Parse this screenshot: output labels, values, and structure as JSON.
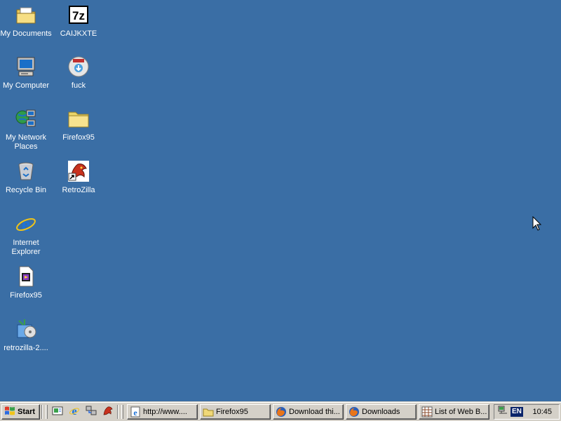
{
  "desktop": {
    "background": "#3a6ea5",
    "icons": [
      {
        "label": "My Documents",
        "icon": "folder-documents-icon"
      },
      {
        "label": "CAIJKXTE",
        "icon": "7z-archive-icon"
      },
      {
        "label": "My Computer",
        "icon": "computer-icon"
      },
      {
        "label": "fuck",
        "icon": "installer-disc-icon"
      },
      {
        "label": "My Network Places",
        "icon": "network-places-icon"
      },
      {
        "label": "Firefox95",
        "icon": "folder-icon"
      },
      {
        "label": "Recycle Bin",
        "icon": "recycle-bin-icon"
      },
      {
        "label": "RetroZilla",
        "icon": "retrozilla-icon"
      },
      {
        "label": "Internet Explorer",
        "icon": "internet-explorer-icon"
      },
      {
        "label": "Firefox95",
        "icon": "media-file-icon"
      },
      {
        "label": "retrozilla-2....",
        "icon": "setup-package-icon"
      }
    ]
  },
  "taskbar": {
    "start_label": "Start",
    "quick_launch": [
      {
        "icon": "show-desktop-icon"
      },
      {
        "icon": "internet-explorer-icon"
      },
      {
        "icon": "network-icon"
      },
      {
        "icon": "retrozilla-icon"
      }
    ],
    "tasks": [
      {
        "label": "http://www....",
        "icon": "ie-page-icon"
      },
      {
        "label": "Firefox95",
        "icon": "folder-icon"
      },
      {
        "label": "Download thi...",
        "icon": "firefox-icon"
      },
      {
        "label": "Downloads",
        "icon": "firefox-icon"
      },
      {
        "label": "List of Web B...",
        "icon": "document-grid-icon"
      }
    ],
    "tray": {
      "language": "EN",
      "clock": "10:45",
      "icon": "network-tray-icon"
    }
  }
}
